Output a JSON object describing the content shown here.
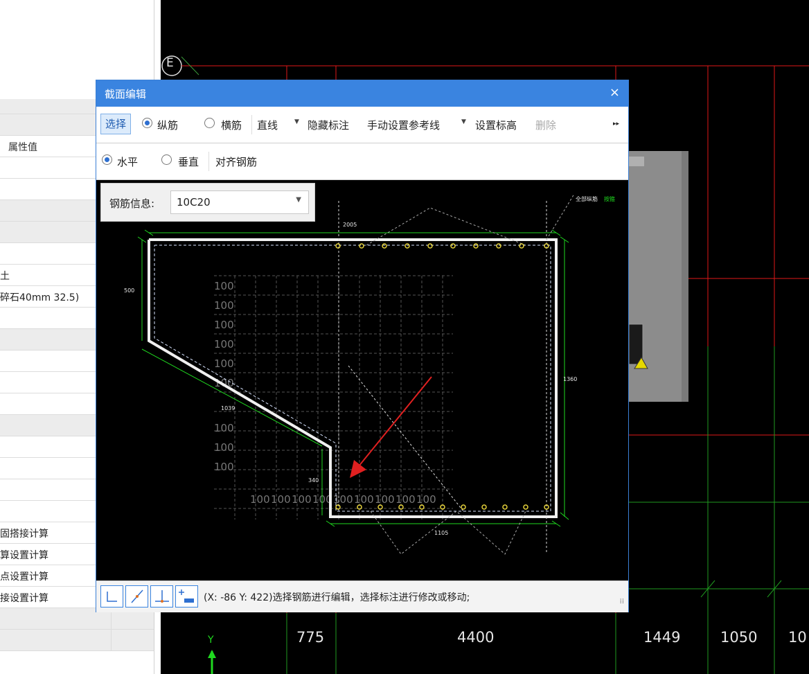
{
  "left_panel": {
    "header": "属性值",
    "values": [
      "",
      "",
      "",
      "",
      "",
      "",
      "",
      "土",
      "碎石40mm 32.5)",
      "",
      "",
      "",
      "",
      "",
      "",
      "",
      "",
      "",
      "",
      "固搭接计算",
      "算设置计算",
      "点设置计算",
      "接设置计算",
      "",
      ""
    ]
  },
  "cad": {
    "axis_label": "E",
    "y_axis": "Y",
    "dims": [
      "775",
      "4400",
      "1449",
      "1050",
      "10"
    ]
  },
  "dialog": {
    "title": "截面编辑",
    "close": "×",
    "toolbar1": {
      "select": "选择",
      "longitudinal": "纵筋",
      "transverse": "横筋",
      "line": "直线",
      "hide_dim": "隐藏标注",
      "ref_line": "手动设置参考线",
      "set_elev": "设置标高",
      "delete": "删除",
      "more": "▸▸"
    },
    "toolbar2": {
      "horizontal": "水平",
      "vertical": "垂直",
      "align": "对齐钢筋"
    },
    "rebar_info": {
      "label": "钢筋信息:",
      "value": "10C20"
    },
    "drawing": {
      "top_dim": "2005",
      "left_dim": "500",
      "right_dim": "1360",
      "slant_dim": "1039",
      "inner_dim": "340",
      "bottom_dim": "1105",
      "grid_label": "100",
      "corner_text_white": "全部纵筋",
      "corner_text_green": "按箍"
    },
    "status": "(X: -86 Y: 422)选择钢筋进行编辑，选择标注进行修改或移动;"
  }
}
